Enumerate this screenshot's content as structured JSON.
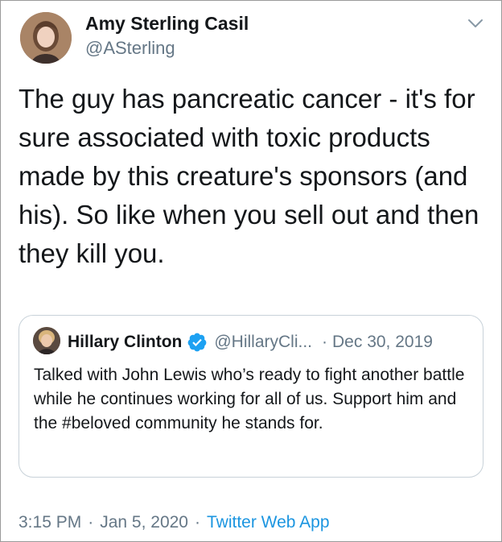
{
  "tweet": {
    "author": {
      "name": "Amy Sterling Casil",
      "handle": "@ASterling"
    },
    "menu_icon": "chevron-down-icon",
    "text": "The guy has pancreatic cancer - it's for sure associated with toxic products made by this creature's sponsors (and his). So like when you sell out and then they kill you.",
    "quoted": {
      "name": "Hillary Clinton",
      "verified_icon": "verified-badge-icon",
      "handle": "@HillaryCli...",
      "separator": "·",
      "date": "Dec 30, 2019",
      "text": "Talked with John Lewis who’s ready to fight another battle while he continues working for all of us. Support him and the #beloved community he stands for."
    },
    "meta": {
      "time": "3:15 PM",
      "separator": "·",
      "date": "Jan 5, 2020",
      "separator2": "·",
      "source": "Twitter Web App"
    },
    "colors": {
      "text": "#14171a",
      "muted": "#657786",
      "link": "#1b95e0",
      "verified": "#1da1f2"
    }
  }
}
